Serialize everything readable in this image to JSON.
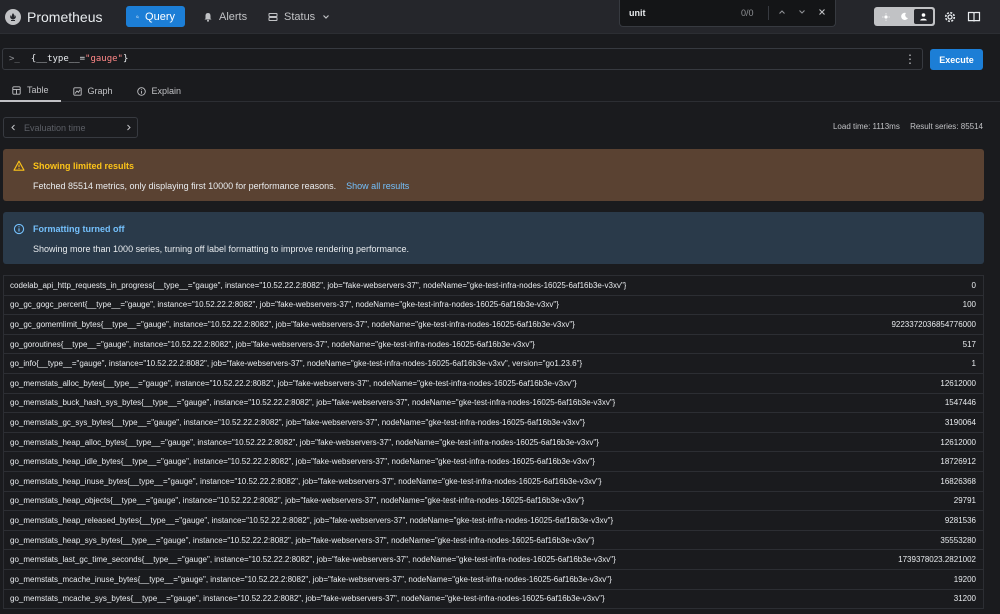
{
  "navbar": {
    "brand": "Prometheus",
    "nav_items": [
      {
        "label": "Query",
        "icon": "search-icon",
        "active": true
      },
      {
        "label": "Alerts",
        "icon": "bell-icon",
        "active": false
      },
      {
        "label": "Status",
        "icon": "server-icon",
        "active": false
      }
    ]
  },
  "find_popup": {
    "query": "unit",
    "count": "0/0"
  },
  "expression": {
    "prompt": ">_",
    "part1": "{__type__=",
    "part2": "\"gauge\"",
    "part3": "}"
  },
  "execute_label": "Execute",
  "tabs": [
    {
      "label": "Table",
      "selected": true
    },
    {
      "label": "Graph",
      "selected": false
    },
    {
      "label": "Explain",
      "selected": false
    }
  ],
  "eval_time": {
    "placeholder": "Evaluation time"
  },
  "stats": {
    "load_time": "Load time: 1113ms",
    "result_series": "Result series: 85514"
  },
  "alert_limited": {
    "title": "Showing limited results",
    "body": "Fetched 85514 metrics, only displaying first 10000 for performance reasons.",
    "link": "Show all results",
    "color": "#fcc419"
  },
  "alert_formatting": {
    "title": "Formatting turned off",
    "body": "Showing more than 1000 series, turning off label formatting to improve rendering performance.",
    "color": "#74c0fc"
  },
  "rows": [
    {
      "metric": "codelab_api_http_requests_in_progress{__type__=\"gauge\", instance=\"10.52.22.2:8082\", job=\"fake-webservers-37\", nodeName=\"gke-test-infra-nodes-16025-6af16b3e-v3xv\"}",
      "value": "0"
    },
    {
      "metric": "go_gc_gogc_percent{__type__=\"gauge\", instance=\"10.52.22.2:8082\", job=\"fake-webservers-37\", nodeName=\"gke-test-infra-nodes-16025-6af16b3e-v3xv\"}",
      "value": "100"
    },
    {
      "metric": "go_gc_gomemlimit_bytes{__type__=\"gauge\", instance=\"10.52.22.2:8082\", job=\"fake-webservers-37\", nodeName=\"gke-test-infra-nodes-16025-6af16b3e-v3xv\"}",
      "value": "9223372036854776000"
    },
    {
      "metric": "go_goroutines{__type__=\"gauge\", instance=\"10.52.22.2:8082\", job=\"fake-webservers-37\", nodeName=\"gke-test-infra-nodes-16025-6af16b3e-v3xv\"}",
      "value": "517"
    },
    {
      "metric": "go_info{__type__=\"gauge\", instance=\"10.52.22.2:8082\", job=\"fake-webservers-37\", nodeName=\"gke-test-infra-nodes-16025-6af16b3e-v3xv\", version=\"go1.23.6\"}",
      "value": "1"
    },
    {
      "metric": "go_memstats_alloc_bytes{__type__=\"gauge\", instance=\"10.52.22.2:8082\", job=\"fake-webservers-37\", nodeName=\"gke-test-infra-nodes-16025-6af16b3e-v3xv\"}",
      "value": "12612000"
    },
    {
      "metric": "go_memstats_buck_hash_sys_bytes{__type__=\"gauge\", instance=\"10.52.22.2:8082\", job=\"fake-webservers-37\", nodeName=\"gke-test-infra-nodes-16025-6af16b3e-v3xv\"}",
      "value": "1547446"
    },
    {
      "metric": "go_memstats_gc_sys_bytes{__type__=\"gauge\", instance=\"10.52.22.2:8082\", job=\"fake-webservers-37\", nodeName=\"gke-test-infra-nodes-16025-6af16b3e-v3xv\"}",
      "value": "3190064"
    },
    {
      "metric": "go_memstats_heap_alloc_bytes{__type__=\"gauge\", instance=\"10.52.22.2:8082\", job=\"fake-webservers-37\", nodeName=\"gke-test-infra-nodes-16025-6af16b3e-v3xv\"}",
      "value": "12612000"
    },
    {
      "metric": "go_memstats_heap_idle_bytes{__type__=\"gauge\", instance=\"10.52.22.2:8082\", job=\"fake-webservers-37\", nodeName=\"gke-test-infra-nodes-16025-6af16b3e-v3xv\"}",
      "value": "18726912"
    },
    {
      "metric": "go_memstats_heap_inuse_bytes{__type__=\"gauge\", instance=\"10.52.22.2:8082\", job=\"fake-webservers-37\", nodeName=\"gke-test-infra-nodes-16025-6af16b3e-v3xv\"}",
      "value": "16826368"
    },
    {
      "metric": "go_memstats_heap_objects{__type__=\"gauge\", instance=\"10.52.22.2:8082\", job=\"fake-webservers-37\", nodeName=\"gke-test-infra-nodes-16025-6af16b3e-v3xv\"}",
      "value": "29791"
    },
    {
      "metric": "go_memstats_heap_released_bytes{__type__=\"gauge\", instance=\"10.52.22.2:8082\", job=\"fake-webservers-37\", nodeName=\"gke-test-infra-nodes-16025-6af16b3e-v3xv\"}",
      "value": "9281536"
    },
    {
      "metric": "go_memstats_heap_sys_bytes{__type__=\"gauge\", instance=\"10.52.22.2:8082\", job=\"fake-webservers-37\", nodeName=\"gke-test-infra-nodes-16025-6af16b3e-v3xv\"}",
      "value": "35553280"
    },
    {
      "metric": "go_memstats_last_gc_time_seconds{__type__=\"gauge\", instance=\"10.52.22.2:8082\", job=\"fake-webservers-37\", nodeName=\"gke-test-infra-nodes-16025-6af16b3e-v3xv\"}",
      "value": "1739378023.2821002"
    },
    {
      "metric": "go_memstats_mcache_inuse_bytes{__type__=\"gauge\", instance=\"10.52.22.2:8082\", job=\"fake-webservers-37\", nodeName=\"gke-test-infra-nodes-16025-6af16b3e-v3xv\"}",
      "value": "19200"
    },
    {
      "metric": "go_memstats_mcache_sys_bytes{__type__=\"gauge\", instance=\"10.52.22.2:8082\", job=\"fake-webservers-37\", nodeName=\"gke-test-infra-nodes-16025-6af16b3e-v3xv\"}",
      "value": "31200"
    }
  ]
}
